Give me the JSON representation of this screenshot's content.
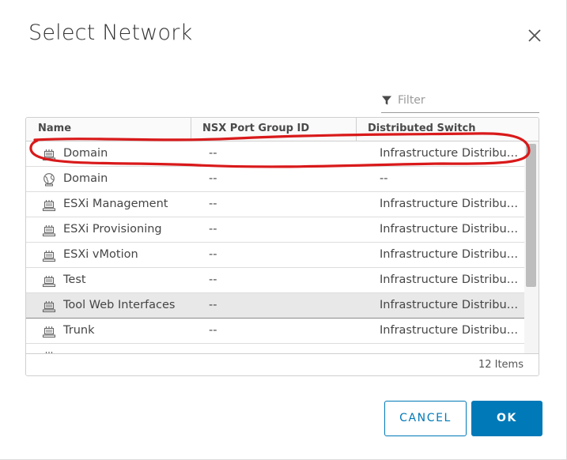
{
  "dialog": {
    "title": "Select Network",
    "close_icon": "close-icon",
    "filter": {
      "placeholder": "Filter",
      "value": "",
      "icon": "filter-funnel-icon"
    },
    "grid": {
      "columns": [
        "Name",
        "NSX Port Group ID",
        "Distributed Switch"
      ],
      "rows": [
        {
          "name": "Domain",
          "nsx_port_group_id": "--",
          "distributed_switch": "Infrastructure Distributed Switch",
          "icon": "distributed-portgroup-icon",
          "selected": false
        },
        {
          "name": "Domain",
          "nsx_port_group_id": "--",
          "distributed_switch": "--",
          "icon": "standard-network-globe-icon",
          "selected": false
        },
        {
          "name": "ESXi Management",
          "nsx_port_group_id": "--",
          "distributed_switch": "Infrastructure Distributed Switch",
          "icon": "distributed-portgroup-icon",
          "selected": false
        },
        {
          "name": "ESXi Provisioning",
          "nsx_port_group_id": "--",
          "distributed_switch": "Infrastructure Distributed Switch",
          "icon": "distributed-portgroup-icon",
          "selected": false
        },
        {
          "name": "ESXi vMotion",
          "nsx_port_group_id": "--",
          "distributed_switch": "Infrastructure Distributed Switch",
          "icon": "distributed-portgroup-icon",
          "selected": false
        },
        {
          "name": "Test",
          "nsx_port_group_id": "--",
          "distributed_switch": "Infrastructure Distributed Switch",
          "icon": "distributed-portgroup-icon",
          "selected": false
        },
        {
          "name": "Tool Web Interfaces",
          "nsx_port_group_id": "--",
          "distributed_switch": "Infrastructure Distributed Switch",
          "icon": "distributed-portgroup-icon",
          "selected": true
        },
        {
          "name": "Trunk",
          "nsx_port_group_id": "--",
          "distributed_switch": "Infrastructure Distributed Switch",
          "icon": "distributed-portgroup-icon",
          "selected": false
        },
        {
          "name": "",
          "nsx_port_group_id": "",
          "distributed_switch": "",
          "icon": "distributed-portgroup-icon",
          "selected": false,
          "partially_visible": true
        }
      ],
      "footer_count": "12 Items"
    },
    "buttons": {
      "cancel": "CANCEL",
      "ok": "OK"
    }
  },
  "colors": {
    "accent": "#0079b8",
    "annotation": "#d9191a",
    "selected_row": "#e8e8e8"
  }
}
